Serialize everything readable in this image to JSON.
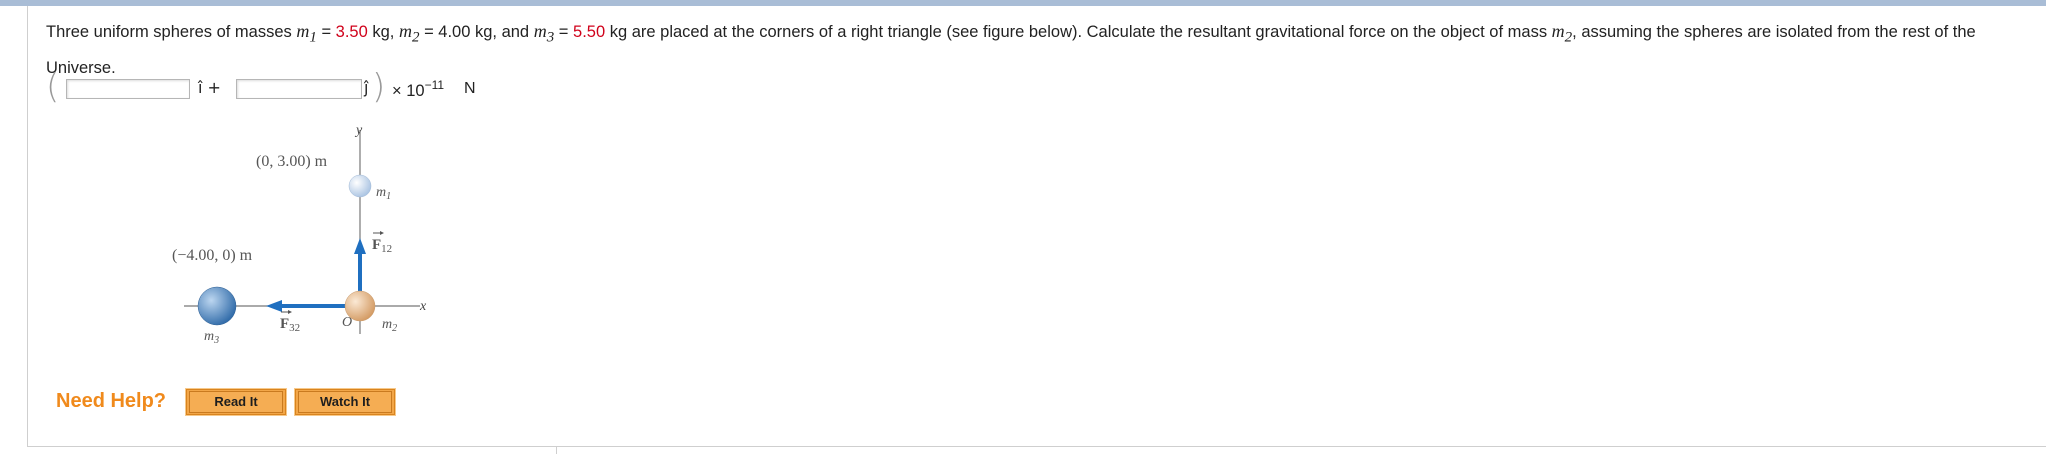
{
  "question": {
    "p1": "Three uniform spheres of masses ",
    "m1_sym": "m",
    "m1_sub": "1",
    "eq": " = ",
    "m1_val": "3.50",
    "kg_m2": " kg, ",
    "m2_sym": "m",
    "m2_sub": "2",
    "m2_text": " = 4.00 kg, and ",
    "m3_sym": "m",
    "m3_sub": "3",
    "m3_val": "5.50",
    "p2": " kg are placed at the corners of a right triangle (see figure below). Calculate the resultant gravitational force on the object of mass ",
    "target_sym": "m",
    "target_sub": "2",
    "p3": ", assuming the spheres are isolated from the rest of the Universe."
  },
  "answer": {
    "open_paren": "(",
    "close_paren": ")",
    "i_hat": "î +",
    "j_hat": "ĵ",
    "times": "× 10",
    "exponent": "−11",
    "unit": "N",
    "x_value": "",
    "y_value": ""
  },
  "figure": {
    "y_axis": "y",
    "x_axis": "x",
    "m1_coord": "(0, 3.00) m",
    "m3_coord": "(−4.00, 0) m",
    "m1_label": "m",
    "m1_sub": "1",
    "m2_label": "m",
    "m2_sub": "2",
    "m3_label": "m",
    "m3_sub": "3",
    "origin": "O",
    "f12": "F",
    "f12_sub": "12",
    "f32": "F",
    "f32_sub": "32"
  },
  "help": {
    "need_help": "Need Help?",
    "read_it": "Read It",
    "watch_it": "Watch It"
  },
  "colors": {
    "given_value": "#d0021b",
    "need_help": "#f08a1c",
    "button": "#f2a648",
    "force_arrow": "#1f6fc0",
    "m1_sphere": "#b9cfe8",
    "m2_sphere": "#e3b98e",
    "m3_sphere": "#4d86c2"
  }
}
